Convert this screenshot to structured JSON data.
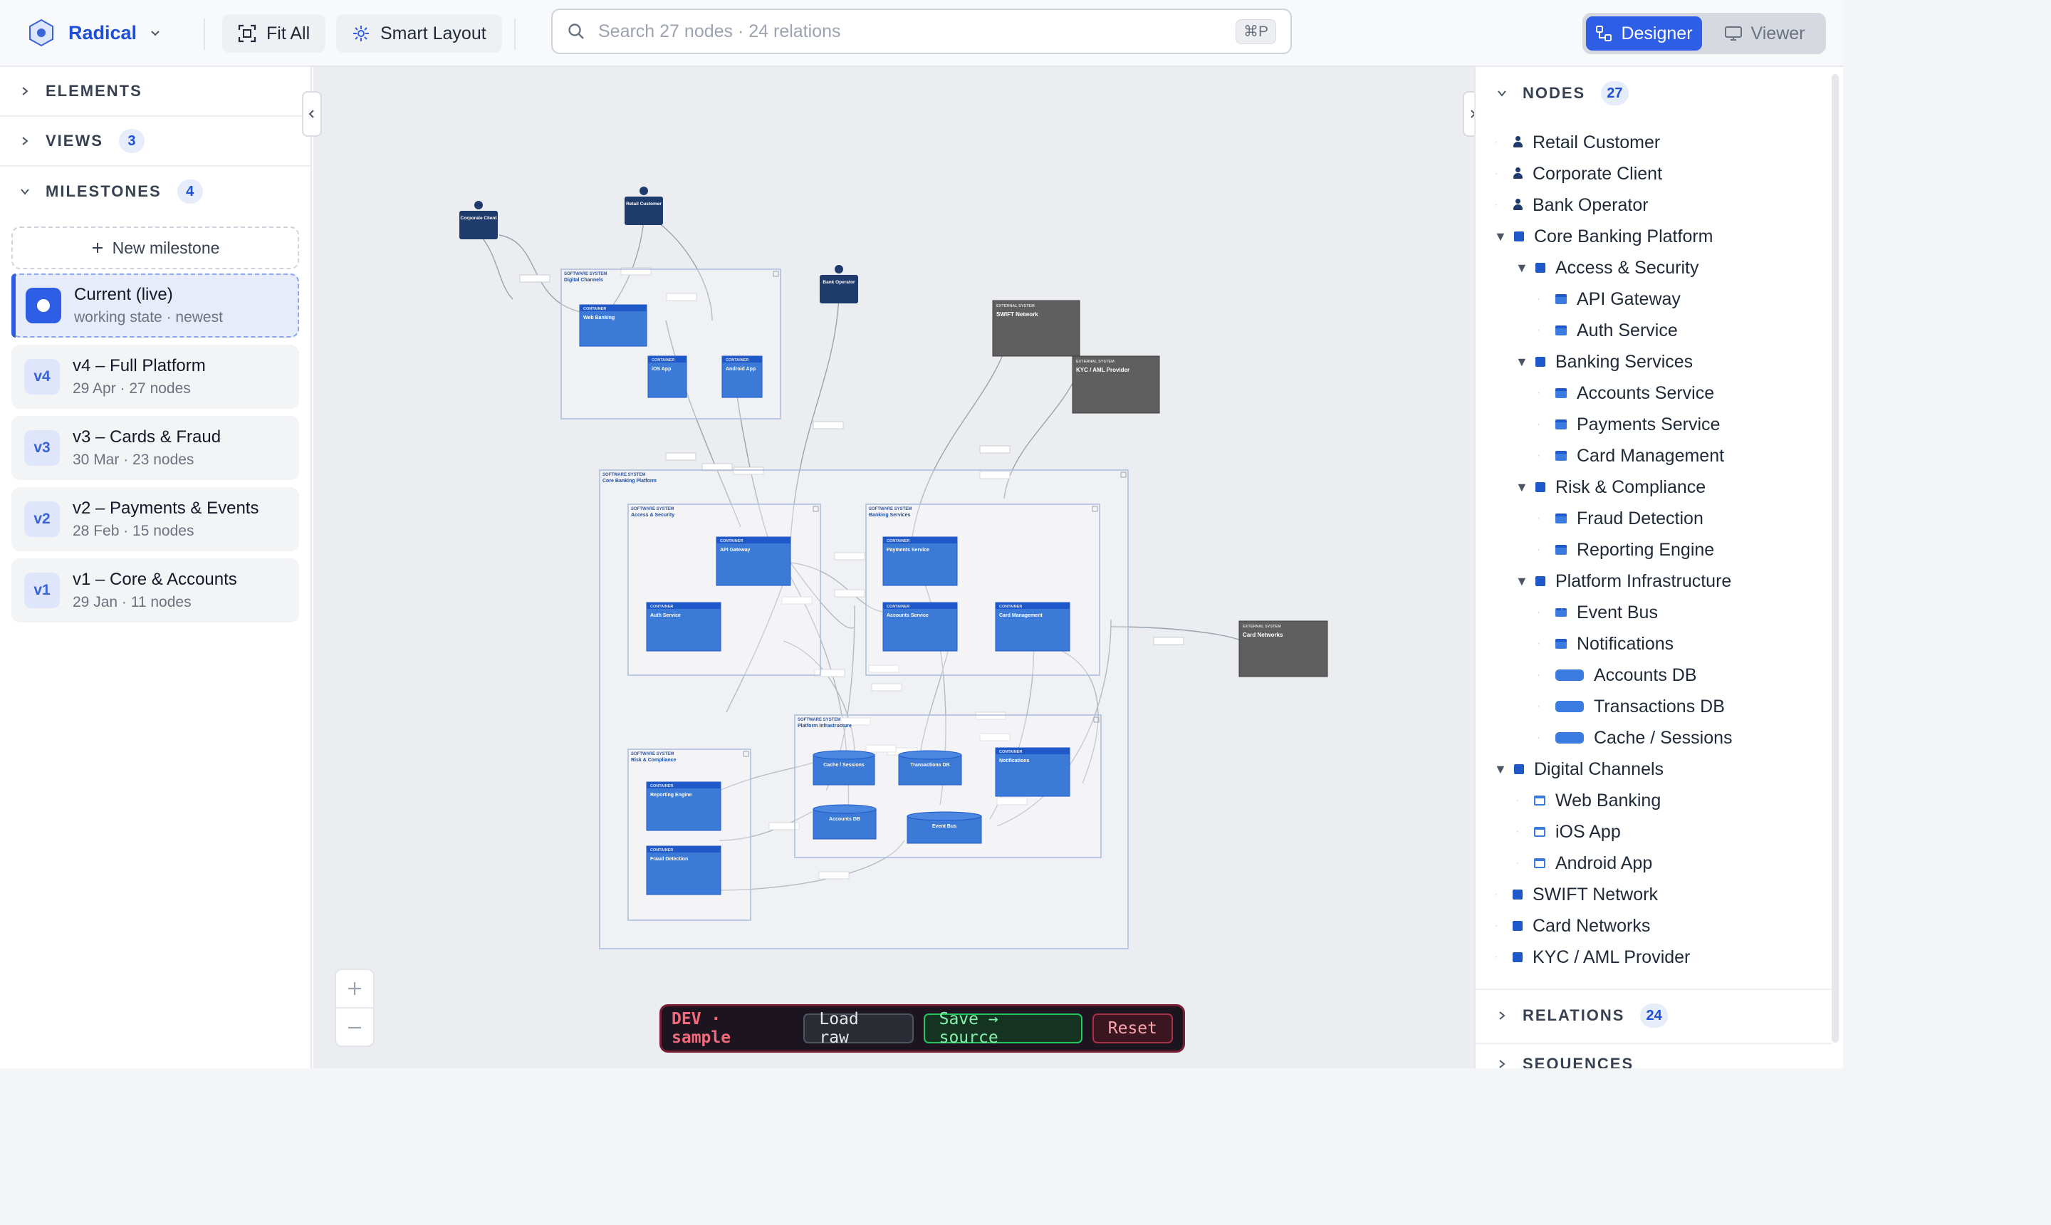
{
  "header": {
    "app_name": "Radical",
    "fit_all": "Fit All",
    "smart_layout": "Smart Layout",
    "search_placeholder": "Search 27 nodes · 24 relations",
    "search_shortcut": "⌘P",
    "mode_designer": "Designer",
    "mode_viewer": "Viewer",
    "active_mode": "Designer"
  },
  "left": {
    "elements": "ELEMENTS",
    "views": "VIEWS",
    "views_count": "3",
    "milestones": "MILESTONES",
    "milestones_count": "4",
    "new_milestone": "New milestone",
    "items": [
      {
        "badge": "",
        "title": "Current (live)",
        "sub": "working state · newest"
      },
      {
        "badge": "v4",
        "title": "v4 – Full Platform",
        "sub": "29 Apr · 27 nodes"
      },
      {
        "badge": "v3",
        "title": "v3 – Cards & Fraud",
        "sub": "30 Mar · 23 nodes"
      },
      {
        "badge": "v2",
        "title": "v2 – Payments & Events",
        "sub": "28 Feb · 15 nodes"
      },
      {
        "badge": "v1",
        "title": "v1 – Core & Accounts",
        "sub": "29 Jan · 11 nodes"
      }
    ]
  },
  "dev": {
    "tag": "DEV · sample",
    "load": "Load raw",
    "save": "Save → source",
    "reset": "Reset"
  },
  "right": {
    "nodes": "NODES",
    "nodes_count": "27",
    "relations": "RELATIONS",
    "relations_count": "24",
    "sequences": "SEQUENCES",
    "tree": [
      {
        "label": "Retail Customer",
        "icon": "person",
        "level": 0,
        "toggle": false
      },
      {
        "label": "Corporate Client",
        "icon": "person",
        "level": 0,
        "toggle": false
      },
      {
        "label": "Bank Operator",
        "icon": "person",
        "level": 0,
        "toggle": false
      },
      {
        "label": "Core Banking Platform",
        "icon": "system",
        "level": 0,
        "toggle": true
      },
      {
        "label": "Access & Security",
        "icon": "system",
        "level": 1,
        "toggle": true
      },
      {
        "label": "API Gateway",
        "icon": "container",
        "level": 2,
        "toggle": false
      },
      {
        "label": "Auth Service",
        "icon": "container",
        "level": 2,
        "toggle": false
      },
      {
        "label": "Banking Services",
        "icon": "system",
        "level": 1,
        "toggle": true
      },
      {
        "label": "Accounts Service",
        "icon": "container",
        "level": 2,
        "toggle": false
      },
      {
        "label": "Payments Service",
        "icon": "container",
        "level": 2,
        "toggle": false
      },
      {
        "label": "Card Management",
        "icon": "container",
        "level": 2,
        "toggle": false
      },
      {
        "label": "Risk & Compliance",
        "icon": "system",
        "level": 1,
        "toggle": true
      },
      {
        "label": "Fraud Detection",
        "icon": "container",
        "level": 2,
        "toggle": false
      },
      {
        "label": "Reporting Engine",
        "icon": "container",
        "level": 2,
        "toggle": false
      },
      {
        "label": "Platform Infrastructure",
        "icon": "system",
        "level": 1,
        "toggle": true
      },
      {
        "label": "Event Bus",
        "icon": "bus",
        "level": 2,
        "toggle": false
      },
      {
        "label": "Notifications",
        "icon": "container",
        "level": 2,
        "toggle": false
      },
      {
        "label": "Accounts DB",
        "icon": "database",
        "level": 2,
        "toggle": false
      },
      {
        "label": "Transactions DB",
        "icon": "database",
        "level": 2,
        "toggle": false
      },
      {
        "label": "Cache / Sessions",
        "icon": "database",
        "level": 2,
        "toggle": false
      },
      {
        "label": "Digital Channels",
        "icon": "system",
        "level": 0,
        "toggle": true
      },
      {
        "label": "Web Banking",
        "icon": "webapp",
        "level": 1,
        "toggle": false
      },
      {
        "label": "iOS App",
        "icon": "webapp",
        "level": 1,
        "toggle": false
      },
      {
        "label": "Android App",
        "icon": "webapp",
        "level": 1,
        "toggle": false
      },
      {
        "label": "SWIFT Network",
        "icon": "system",
        "level": 0,
        "toggle": false
      },
      {
        "label": "Card Networks",
        "icon": "system",
        "level": 0,
        "toggle": false
      },
      {
        "label": "KYC / AML Provider",
        "icon": "system",
        "level": 0,
        "toggle": false
      }
    ]
  },
  "diagram": {
    "kind_software_system": "SOFTWARE SYSTEM",
    "kind_container": "CONTAINER",
    "kind_external": "EXTERNAL SYSTEM",
    "people": [
      "Corporate Client",
      "Retail Customer",
      "Bank Operator"
    ],
    "groups": [
      "Digital Channels",
      "Core Banking Platform",
      "Access & Security",
      "Banking Services",
      "Risk & Compliance",
      "Platform Infrastructure"
    ],
    "containers": [
      "Web Banking",
      "iOS App",
      "Android App",
      "API Gateway",
      "Auth Service",
      "Payments Service",
      "Accounts Service",
      "Card Management",
      "Reporting Engine",
      "Fraud Detection",
      "Notifications"
    ],
    "databases": [
      "Cache / Sessions",
      "Transactions DB",
      "Accounts DB",
      "Event Bus"
    ],
    "externals": [
      "SWIFT Network",
      "KYC / AML Provider",
      "Card Networks"
    ],
    "colors": {
      "container": "#3b7ad6",
      "person": "#1f3b6b",
      "external": "#5f5f5f",
      "group_border": "#a9bbdc"
    }
  }
}
